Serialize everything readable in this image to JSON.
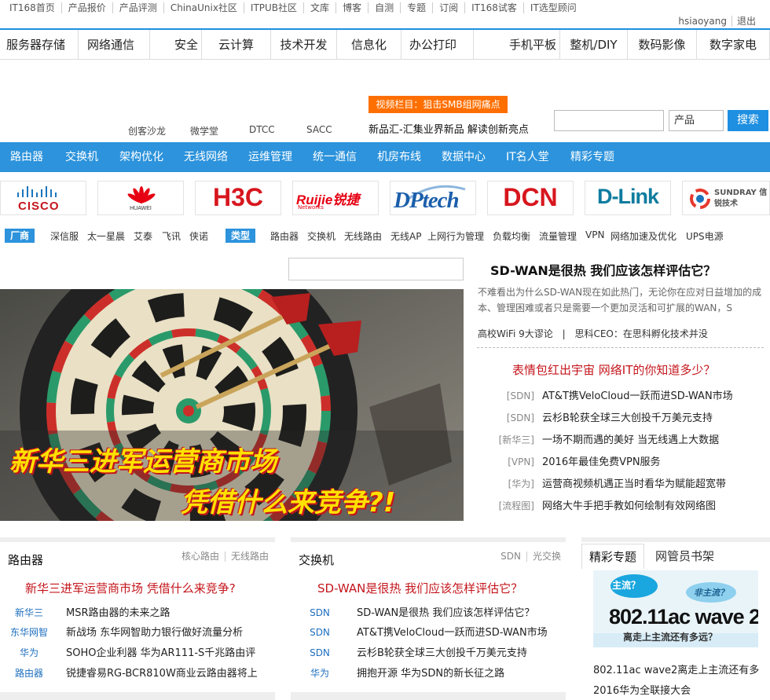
{
  "topbar": {
    "links": [
      "IT168首页",
      "产品报价",
      "产品评测",
      "ChinaUnix社区",
      "ITPUB社区",
      "文库",
      "博客",
      "自测",
      "专题",
      "订阅",
      "IT168试客",
      "IT选型顾问"
    ],
    "username": "hsiaoyang",
    "logout": "退出"
  },
  "channels": [
    "服务器存储",
    "网络通信",
    "安全",
    "云计算",
    "技术开发",
    "信息化",
    "办公打印",
    "手机平板",
    "整机/DIY",
    "数码影像",
    "数字家电"
  ],
  "promo": {
    "tag": "视频栏目：狙击SMB组网痛点",
    "text": "新品汇-汇集业界新品 解读创新亮点",
    "sublinks": [
      "创客沙龙",
      "微学堂",
      "DTCC",
      "SACC"
    ]
  },
  "search": {
    "select": "产品",
    "button": "搜索"
  },
  "blue_nav": [
    "路由器",
    "交换机",
    "架构优化",
    "无线网络",
    "运维管理",
    "统一通信",
    "机房布线",
    "数据中心",
    "IT名人堂",
    "精彩专题"
  ],
  "brands": [
    "CISCO",
    "HUAWEI",
    "H3C",
    "Ruijie锐捷",
    "DPtech",
    "DCN",
    "D-Link",
    "SUNDRAY 信锐技术"
  ],
  "brand_networks": "Networks",
  "brand_colors": {
    "cisco": "#1b75bb",
    "huawei": "#e60012",
    "h3c": "#d7161e",
    "ruijie": "#e60012",
    "dptech": "#1b5fab",
    "dcn": "#d7161e",
    "dlink": "#0e7c9f"
  },
  "filters": {
    "vendor_label": "厂商",
    "vendors": [
      "深信服",
      "太一星晨",
      "艾泰",
      "飞讯",
      "侠诺"
    ],
    "type_label": "类型",
    "types": [
      "路由器",
      "交换机",
      "无线路由",
      "无线AP",
      "上网行为管理",
      "负载均衡",
      "流量管理",
      "VPN",
      "网络加速及优化",
      "UPS电源"
    ]
  },
  "hero": {
    "line1": "新华三进军运营商市场",
    "line2": "凭借什么来竞争?!"
  },
  "news": {
    "title": "SD-WAN是很热 我们应该怎样评估它？",
    "summary": "不难看出为什么SD-WAN现在如此热门，无论你在应对日益增加的成本、管理困难或者只是需要一个更加灵活和可扩展的WAN，S",
    "link1": "高校WiFi 9大谬论",
    "sep": "|",
    "link2": "思科CEO：在思科孵化技术并没",
    "red_headline": "表情包红出宇宙 网络IT的你知道多少？",
    "items": [
      {
        "cat": "[SDN]",
        "text": "AT&T携VeloCloud一跃而进SD-WAN市场"
      },
      {
        "cat": "[SDN]",
        "text": "云杉B轮获全球三大创投千万美元支持"
      },
      {
        "cat": "[新华三]",
        "text": "一场不期而遇的美好 当无线遇上大数据"
      },
      {
        "cat": "[VPN]",
        "text": "2016年最佳免费VPN服务"
      },
      {
        "cat": "[华为]",
        "text": "运营商视频机遇正当时看华为赋能超宽带"
      },
      {
        "cat": "[流程图]",
        "text": "网络大牛手把手教如何绘制有效网络图"
      }
    ]
  },
  "module_router": {
    "title": "路由器",
    "links": [
      "核心路由",
      "无线路由"
    ],
    "headline": "新华三进军运营商市场 凭借什么来竞争?",
    "rows": [
      {
        "cat": "新华三",
        "text": "MSR路由器的未来之路"
      },
      {
        "cat": "东华网智",
        "text": "新战场 东华网智助力银行做好流量分析"
      },
      {
        "cat": "华为",
        "text": "SOHO企业利器 华为AR111-S千兆路由评"
      },
      {
        "cat": "路由器",
        "text": "锐捷睿易RG-BCR810W商业云路由器将上"
      }
    ]
  },
  "module_switch": {
    "title": "交换机",
    "links": [
      "SDN",
      "光交换"
    ],
    "headline": "SD-WAN是很热 我们应该怎样评估它？",
    "rows": [
      {
        "cat": "SDN",
        "text": "SD-WAN是很热 我们应该怎样评估它？"
      },
      {
        "cat": "SDN",
        "text": "AT&T携VeloCloud一跃而进SD-WAN市场"
      },
      {
        "cat": "SDN",
        "text": "云杉B轮获全球三大创投千万美元支持"
      },
      {
        "cat": "华为",
        "text": "拥抱开源 华为SDN的新长征之路"
      }
    ]
  },
  "special": {
    "tab_active": "精彩专题",
    "tab_other": "网管员书架",
    "bubble1": "主流？",
    "bubble2": "非主流？",
    "img_title": "802.11ac wave 2",
    "img_sub": "离走上主流还有多远？",
    "caption1": "802.11ac wave2离走上主流还有多",
    "caption2": "2016华为全联接大会"
  }
}
